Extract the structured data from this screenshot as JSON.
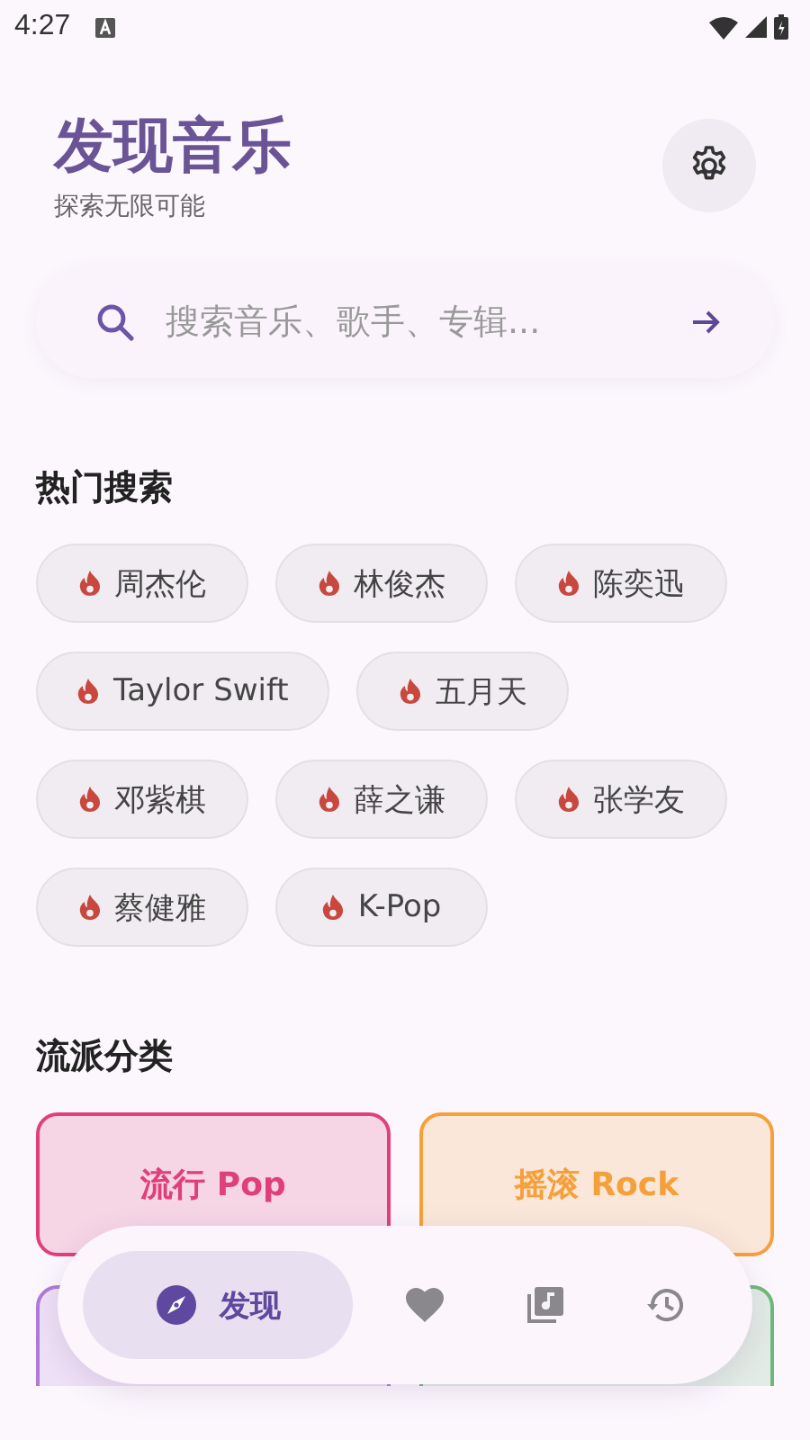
{
  "status_bar": {
    "time": "4:27"
  },
  "header": {
    "title": "发现音乐",
    "subtitle": "探索无限可能"
  },
  "search": {
    "placeholder": "搜索音乐、歌手、专辑..."
  },
  "hot_search": {
    "title": "热门搜索",
    "chips": [
      {
        "label": "周杰伦"
      },
      {
        "label": "林俊杰"
      },
      {
        "label": "陈奕迅"
      },
      {
        "label": "Taylor Swift"
      },
      {
        "label": "五月天"
      },
      {
        "label": "邓紫棋"
      },
      {
        "label": "薛之谦"
      },
      {
        "label": "张学友"
      },
      {
        "label": "蔡健雅"
      },
      {
        "label": "K-Pop"
      }
    ]
  },
  "genres": {
    "title": "流派分类",
    "items": [
      {
        "label": "流行 Pop",
        "color": "#e0407a"
      },
      {
        "label": "摇滚 Rock",
        "color": "#f5a03a"
      },
      {
        "color": "#b07ad8"
      },
      {
        "color": "#6fb87a"
      }
    ]
  },
  "bottom_nav": {
    "items": [
      {
        "label": "发现",
        "selected": true
      },
      {
        "selected": false
      },
      {
        "selected": false
      },
      {
        "selected": false
      }
    ]
  }
}
